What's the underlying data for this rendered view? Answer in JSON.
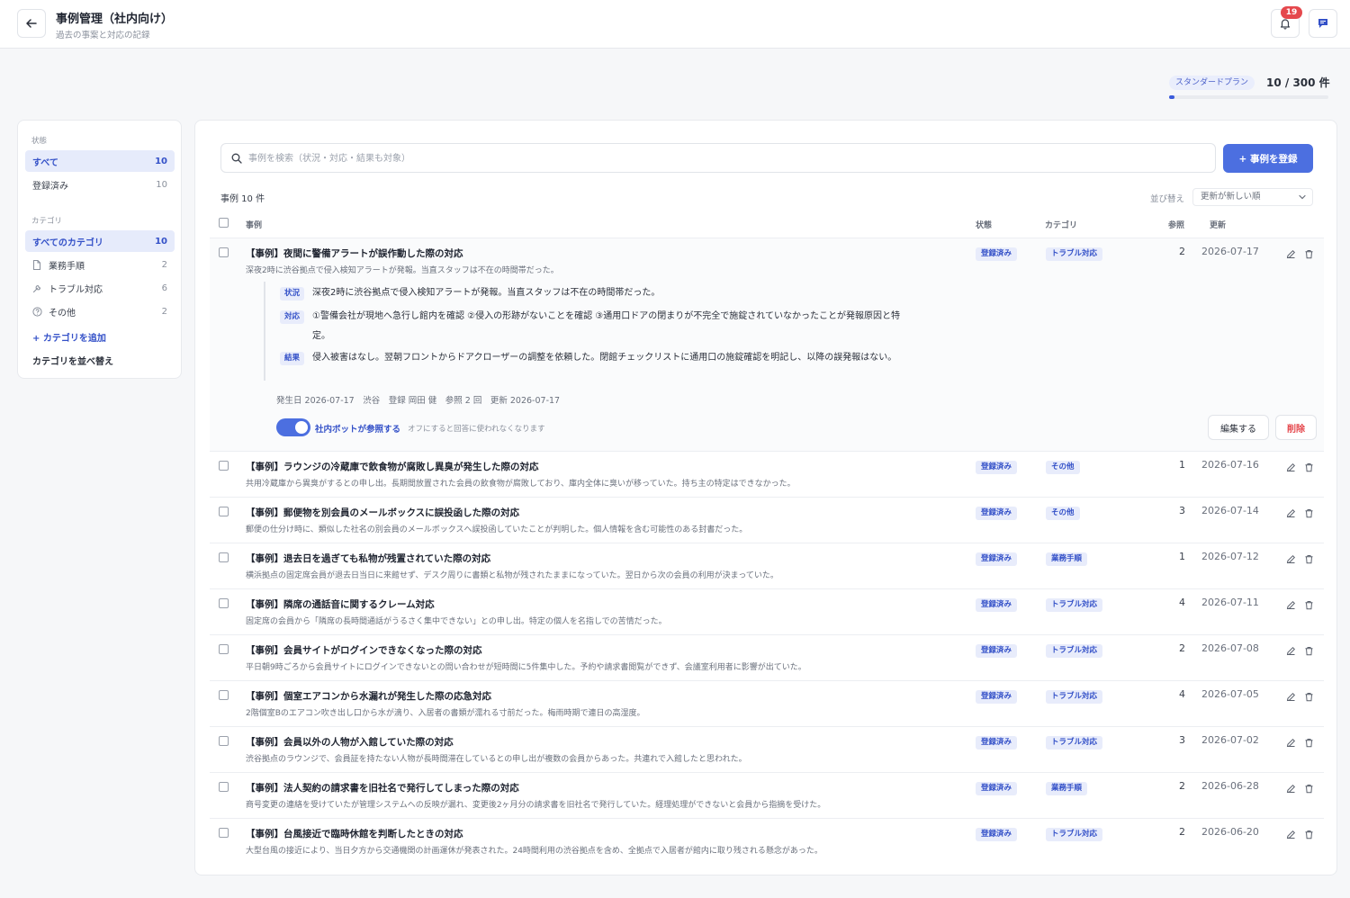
{
  "header": {
    "title": "事例管理（社内向け）",
    "subtitle": "過去の事案と対応の記録",
    "notification_count": "19"
  },
  "plan": {
    "name": "スタンダードプラン",
    "usage": "10 / 300 件",
    "usage_fraction": 0.033
  },
  "sidebar": {
    "status_heading": "状態",
    "status_items": [
      {
        "label": "すべて",
        "count": "10"
      },
      {
        "label": "登録済み",
        "count": "10"
      }
    ],
    "category_heading": "カテゴリ",
    "category_items": [
      {
        "label": "すべてのカテゴリ",
        "count": "10",
        "icon": ""
      },
      {
        "label": "業務手順",
        "count": "2",
        "icon": "document-icon"
      },
      {
        "label": "トラブル対応",
        "count": "6",
        "icon": "wrench-icon"
      },
      {
        "label": "その他",
        "count": "2",
        "icon": "help-circle-icon"
      }
    ],
    "add_category": "+ カテゴリを追加",
    "sort_categories": "カテゴリを並べ替え"
  },
  "toolbar": {
    "search_placeholder": "事例を検索（状況・対応・結果も対象）",
    "add_button": "+ 事例を登録",
    "case_count": "事例 10 件",
    "sort_label": "並び替え",
    "sort_value": "更新が新しい順"
  },
  "table": {
    "headers": {
      "case": "事例",
      "status": "状態",
      "category": "カテゴリ",
      "refs": "参照",
      "updated": "更新"
    },
    "rows": [
      {
        "title": "【事例】夜間に警備アラートが誤作動した際の対応",
        "summary": "深夜2時に渋谷拠点で侵入検知アラートが発報。当直スタッフは不在の時間帯だった。",
        "status": "登録済み",
        "category": "トラブル対応",
        "refs": "2",
        "updated": "2026-07-17"
      },
      {
        "title": "【事例】ラウンジの冷蔵庫で飲食物が腐敗し異臭が発生した際の対応",
        "summary": "共用冷蔵庫から異臭がするとの申し出。長期間放置された会員の飲食物が腐敗しており、庫内全体に臭いが移っていた。持ち主の特定はできなかった。",
        "status": "登録済み",
        "category": "その他",
        "refs": "1",
        "updated": "2026-07-16"
      },
      {
        "title": "【事例】郵便物を別会員のメールボックスに誤投函した際の対応",
        "summary": "郵便の仕分け時に、類似した社名の別会員のメールボックスへ誤投函していたことが判明した。個人情報を含む可能性のある封書だった。",
        "status": "登録済み",
        "category": "その他",
        "refs": "3",
        "updated": "2026-07-14"
      },
      {
        "title": "【事例】退去日を過ぎても私物が残置されていた際の対応",
        "summary": "横浜拠点の固定席会員が退去日当日に来館せず、デスク周りに書類と私物が残されたままになっていた。翌日から次の会員の利用が決まっていた。",
        "status": "登録済み",
        "category": "業務手順",
        "refs": "1",
        "updated": "2026-07-12"
      },
      {
        "title": "【事例】隣席の通話音に関するクレーム対応",
        "summary": "固定席の会員から「隣席の長時間通話がうるさく集中できない」との申し出。特定の個人を名指しでの苦情だった。",
        "status": "登録済み",
        "category": "トラブル対応",
        "refs": "4",
        "updated": "2026-07-11"
      },
      {
        "title": "【事例】会員サイトがログインできなくなった際の対応",
        "summary": "平日朝9時ごろから会員サイトにログインできないとの問い合わせが短時間に5件集中した。予約や請求書閲覧ができず、会議室利用者に影響が出ていた。",
        "status": "登録済み",
        "category": "トラブル対応",
        "refs": "2",
        "updated": "2026-07-08"
      },
      {
        "title": "【事例】個室エアコンから水漏れが発生した際の応急対応",
        "summary": "2階個室Bのエアコン吹き出し口から水が滴り、入居者の書類が濡れる寸前だった。梅雨時期で連日の高湿度。",
        "status": "登録済み",
        "category": "トラブル対応",
        "refs": "4",
        "updated": "2026-07-05"
      },
      {
        "title": "【事例】会員以外の人物が入館していた際の対応",
        "summary": "渋谷拠点のラウンジで、会員証を持たない人物が長時間滞在しているとの申し出が複数の会員からあった。共連れで入館したと思われた。",
        "status": "登録済み",
        "category": "トラブル対応",
        "refs": "3",
        "updated": "2026-07-02"
      },
      {
        "title": "【事例】法人契約の請求書を旧社名で発行してしまった際の対応",
        "summary": "商号変更の連絡を受けていたが管理システムへの反映が漏れ、変更後2ヶ月分の請求書を旧社名で発行していた。経理処理ができないと会員から指摘を受けた。",
        "status": "登録済み",
        "category": "業務手順",
        "refs": "2",
        "updated": "2026-06-28"
      },
      {
        "title": "【事例】台風接近で臨時休館を判断したときの対応",
        "summary": "大型台風の接近により、当日夕方から交通機関の計画運休が発表された。24時間利用の渋谷拠点を含め、全拠点で入居者が館内に取り残される懸念があった。",
        "status": "登録済み",
        "category": "トラブル対応",
        "refs": "2",
        "updated": "2026-06-20"
      }
    ]
  },
  "detail": {
    "situation_tag": "状況",
    "situation_text": "深夜2時に渋谷拠点で侵入検知アラートが発報。当直スタッフは不在の時間帯だった。",
    "response_tag": "対応",
    "response_text": "①警備会社が現地へ急行し館内を確認 ②侵入の形跡がないことを確認 ③通用口ドアの閉まりが不完全で施錠されていなかったことが発報原因と特定。",
    "result_tag": "結果",
    "result_text": "侵入被害はなし。翌朝フロントからドアクローザーの調整を依頼した。閉館チェックリストに通用口の施錠確認を明記し、以降の誤発報はない。",
    "meta": "発生日 2026-07-17　渋谷　登録 岡田 健　参照 2 回　更新 2026-07-17",
    "bot_toggle_label": "社内ボットが参照する",
    "bot_toggle_note": "オフにすると回答に使われなくなります",
    "edit_button": "編集する",
    "delete_button": "削除"
  }
}
